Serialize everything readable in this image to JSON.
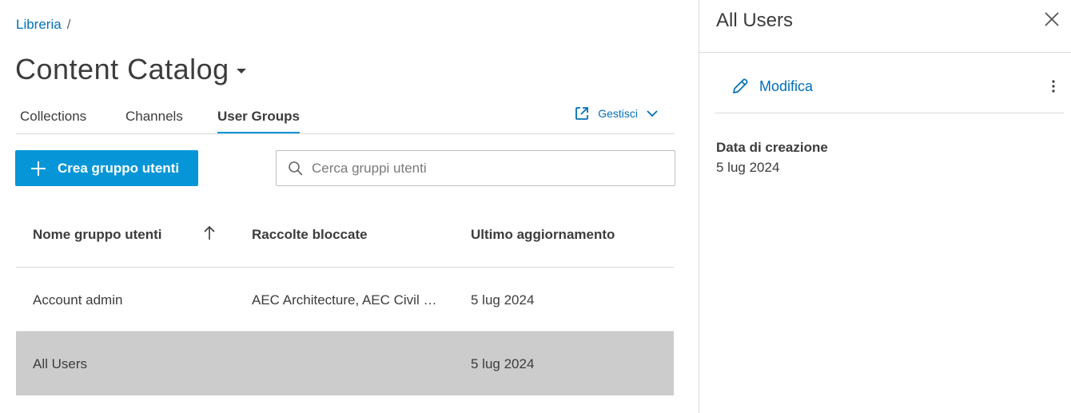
{
  "breadcrumb": {
    "root": "Libreria",
    "separator": "/"
  },
  "page": {
    "title": "Content Catalog"
  },
  "tabs": [
    {
      "label": "Collections",
      "active": false
    },
    {
      "label": "Channels",
      "active": false
    },
    {
      "label": "User Groups",
      "active": true
    }
  ],
  "manage": {
    "label": "Gestisci",
    "icon": "external-link-icon"
  },
  "create_button": {
    "label": "Crea gruppo utenti",
    "icon": "plus-icon"
  },
  "search": {
    "placeholder": "Cerca gruppi utenti",
    "value": "",
    "icon": "search-icon"
  },
  "table": {
    "columns": [
      "Nome gruppo utenti",
      "Raccolte bloccate",
      "Ultimo aggiornamento"
    ],
    "sort": {
      "column": "Nome gruppo utenti",
      "direction": "ascending",
      "icon": "arrow-up-icon"
    },
    "rows": [
      {
        "name": "Account admin",
        "locked_collections": "AEC Architecture, AEC Civil Engineering",
        "updated": "5 lug 2024",
        "selected": false
      },
      {
        "name": "All Users",
        "locked_collections": "",
        "updated": "5 lug 2024",
        "selected": true
      }
    ]
  },
  "panel": {
    "title": "All Users",
    "edit_label": "Modifica",
    "created_label": "Data di creazione",
    "created_value": "5 lug 2024"
  },
  "colors": {
    "accent": "#0696d7",
    "link": "#0070b8",
    "text": "#3c3c3c",
    "selected_row": "#cccccc",
    "divider": "#d9d9d9"
  }
}
